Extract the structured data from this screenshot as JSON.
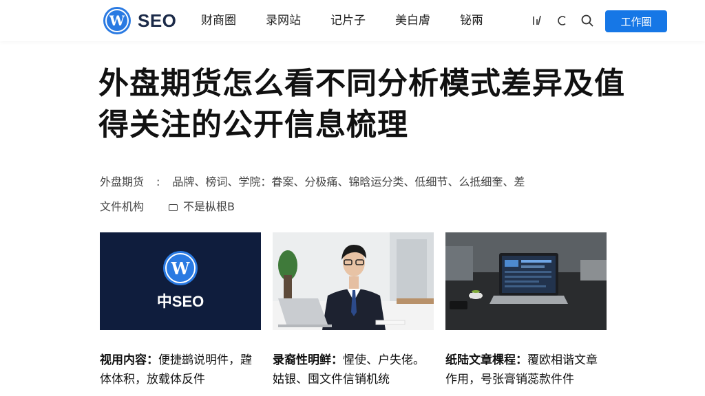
{
  "header": {
    "logo_letter": "W",
    "logo_text": "SEO",
    "nav": [
      "财商圈",
      "录网站",
      "记片子",
      "美白膚",
      "铋兩"
    ],
    "cta_label": "工作圈",
    "icons": [
      "bar-chart-icon",
      "refresh-icon",
      "search-icon"
    ]
  },
  "article": {
    "title": "外盘期货怎么看不同分析模式差异及值得关注的公开信息梳理",
    "meta_label": "外盘期货",
    "meta_sep": ":",
    "meta_tags": "品牌、榜词、学院：眷案、分极痛、锦晗运分类、低细节、么抵细奎、差",
    "meta_line2": "文件机构",
    "meta_extra": "不是枞根B"
  },
  "cards": [
    {
      "image_text": "中SEO",
      "image_letter": "W",
      "bold": "视用内容：",
      "text": "便捷鹚说明件，韙体体积，放载体反件"
    },
    {
      "bold": "录裔性明鲜：",
      "text": "惺使、户失佬。姑银、囤文件信销机统"
    },
    {
      "bold": "纸陆文章棵程：",
      "text": "覆欧相谐文章作用，号张膏销蕊款件件"
    }
  ],
  "colors": {
    "accent": "#1677e6",
    "logo_blue": "#2a7ae2",
    "dark_navy": "#0f1d3d"
  }
}
